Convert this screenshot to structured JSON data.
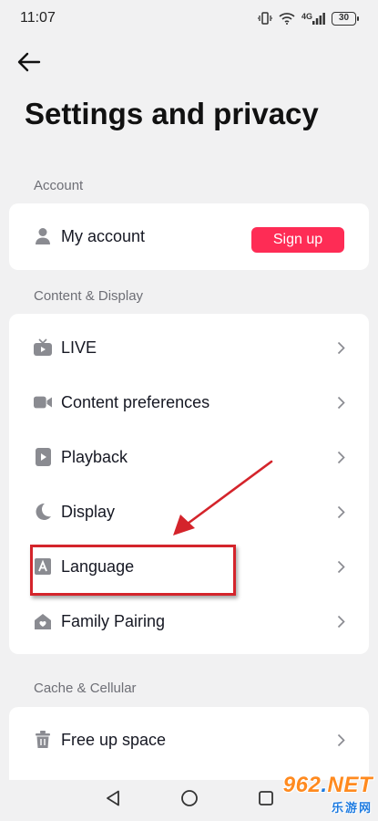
{
  "status_bar": {
    "time": "11:07",
    "network": "4G",
    "battery": "30"
  },
  "page": {
    "title": "Settings and privacy"
  },
  "sections": {
    "account": {
      "label": "Account",
      "items": [
        {
          "label": "My account",
          "icon": "person-icon",
          "action_label": "Sign up"
        }
      ]
    },
    "content_display": {
      "label": "Content & Display",
      "items": [
        {
          "label": "LIVE",
          "icon": "live-tv-icon"
        },
        {
          "label": "Content preferences",
          "icon": "video-camera-icon"
        },
        {
          "label": "Playback",
          "icon": "play-icon"
        },
        {
          "label": "Display",
          "icon": "moon-icon"
        },
        {
          "label": "Language",
          "icon": "language-a-icon"
        },
        {
          "label": "Family Pairing",
          "icon": "home-icon"
        }
      ]
    },
    "cache_cellular": {
      "label": "Cache & Cellular",
      "items": [
        {
          "label": "Free up space",
          "icon": "trash-icon"
        }
      ]
    }
  },
  "annotation": {
    "highlighted_item": "Language",
    "color": "#d4242b"
  },
  "colors": {
    "accent": "#fe2c55",
    "background": "#f1f1f2",
    "card": "#ffffff",
    "section_text": "#6e6f76"
  },
  "watermark": {
    "main_prefix": "962",
    "main_dot": ".",
    "main_suffix": "NET",
    "sub": "乐游网"
  }
}
